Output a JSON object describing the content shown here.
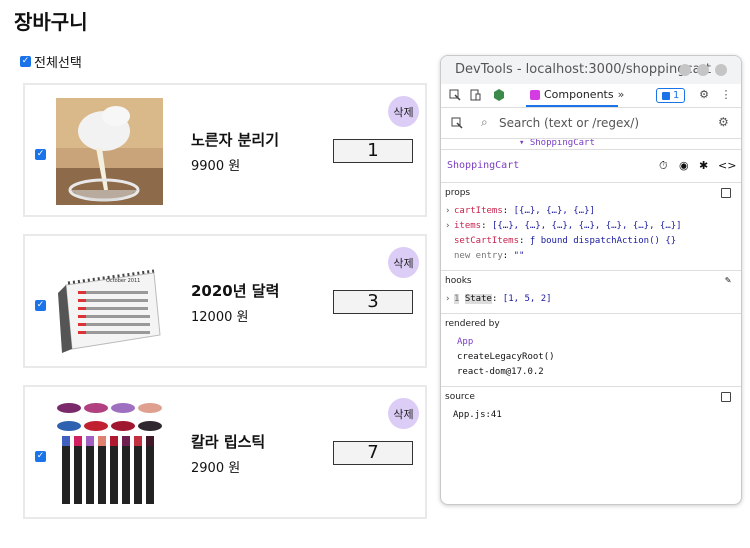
{
  "page": {
    "title": "장바구니"
  },
  "select_all": {
    "label": "전체선택",
    "checked": true
  },
  "cart": {
    "items": [
      {
        "name": "노른자 분리기",
        "price": "9900 원",
        "quantity": "1",
        "delete_label": "삭제",
        "image": "egg-separator-photo"
      },
      {
        "name": "2020년 달력",
        "price": "12000 원",
        "quantity": "3",
        "delete_label": "삭제",
        "image": "desk-calendar-photo"
      },
      {
        "name": "칼라 립스틱",
        "price": "2900 원",
        "quantity": "7",
        "delete_label": "삭제",
        "image": "lipstick-photo"
      }
    ]
  },
  "devtools": {
    "title": "DevTools - localhost:3000/shoppingcart",
    "tabs": {
      "components": "Components",
      "more": "»"
    },
    "issues_count": "1",
    "search_placeholder": "Search (text or /regex/)",
    "breadcrumb": "ShoppingCart",
    "component_name": "ShoppingCart",
    "props": {
      "title": "props",
      "cartItems_key": "cartItems",
      "cartItems_val": "[{…}, {…}, {…}]",
      "items_key": "items",
      "items_val": "[{…}, {…}, {…}, {…}, {…}, {…}, {…}]",
      "setCartItems_key": "setCartItems",
      "setCartItems_val": "ƒ bound dispatchAction() {}",
      "new_entry_label": "new entry",
      "new_entry_val": "\"\""
    },
    "hooks": {
      "title": "hooks",
      "index": "1",
      "state_label": "State",
      "state_val": "[1, 5, 2]"
    },
    "rendered_by": {
      "title": "rendered by",
      "lines": [
        "App",
        "createLegacyRoot()",
        "react-dom@17.0.2"
      ]
    },
    "source": {
      "title": "source",
      "file": "App.js:41"
    }
  }
}
